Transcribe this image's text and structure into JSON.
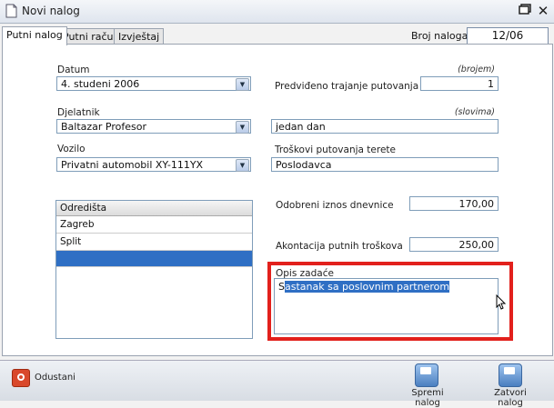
{
  "window": {
    "title": "Novi nalog"
  },
  "tabs": [
    {
      "label": "Putni nalog",
      "active": true
    },
    {
      "label": "Putni račun",
      "active": false
    },
    {
      "label": "Izvještaj",
      "active": false
    }
  ],
  "broj": {
    "label": "Broj naloga :",
    "value": "12/06"
  },
  "form": {
    "datum_label": "Datum",
    "datum_value": "4. studeni 2006",
    "djelatnik_label": "Djelatnik",
    "djelatnik_value": "Baltazar Profesor",
    "vozilo_label": "Vozilo",
    "vozilo_value": "Privatni automobil XY-111YX",
    "trajanje_hint": "(brojem)",
    "trajanje_label": "Predviđeno trajanje putovanja je",
    "trajanje_value": "1",
    "slovima_hint": "(slovima)",
    "slovima_value": "jedan dan",
    "troskovi_label": "Troškovi putovanja terete",
    "troskovi_value": "Poslodavca",
    "dnevnice_label": "Odobreni iznos dnevnice",
    "dnevnice_value": "170,00",
    "akontacija_label": "Akontacija putnih troškova",
    "akontacija_value": "250,00",
    "opis_label": "Opis zadaće",
    "opis_value_prefix": "S",
    "opis_value_selected": "astanak sa poslovnim partnerom"
  },
  "odredista": {
    "header": "Odredišta",
    "items": [
      "Zagreb",
      "Split",
      ""
    ]
  },
  "bottom": {
    "odustani": "Odustani",
    "spremi": "Spremi nalog",
    "zatvori": "Zatvori nalog"
  },
  "colors": {
    "highlight": "#e2201c",
    "selection": "#2f6fc4"
  }
}
